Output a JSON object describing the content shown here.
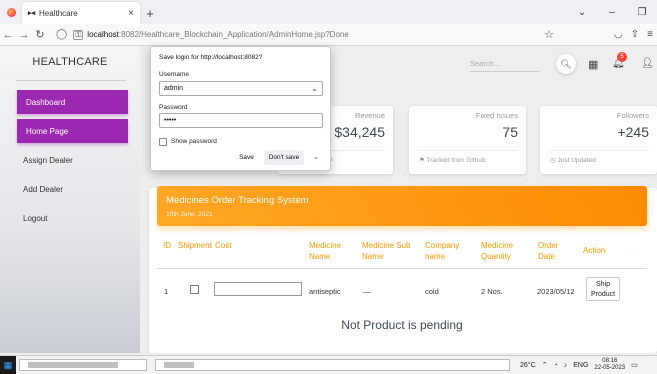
{
  "browser": {
    "tab_title": "Healthcare",
    "tab_icon": "healthcare-logo",
    "url_host": "localhost",
    "url_path": ":8082/Healthcare_Blockchain_Application/AdminHome.jsp?Done"
  },
  "sidebar": {
    "brand": "HEALTHCARE",
    "items": [
      {
        "label": "Dashboard",
        "active": true
      },
      {
        "label": "Home Page",
        "active": true
      },
      {
        "label": "Assign Dealer",
        "active": false
      },
      {
        "label": "Add Dealer",
        "active": false
      },
      {
        "label": "Logout",
        "active": false
      }
    ]
  },
  "header": {
    "search_placeholder": "Search...",
    "notification_count": "5"
  },
  "stats": [
    {
      "label": "Revenue",
      "value": "$34,245",
      "footer": "...s"
    },
    {
      "label": "Fixed Issues",
      "value": "75",
      "footer": "Tracked from Github"
    },
    {
      "label": "Followers",
      "value": "+245",
      "footer": "Just Updated"
    }
  ],
  "orders": {
    "title": "Medicines Order Tracking System",
    "date": "10th June, 2021",
    "columns": [
      "ID",
      "Shipment",
      "Cost",
      "Medicine Name",
      "Medicine Sub Name",
      "Company name",
      "Medicine Quantity",
      "Order Date",
      "Action"
    ],
    "row": {
      "id": "1",
      "medicine_name": "antiseptic",
      "sub_name": "—",
      "company": "cold",
      "quantity": "2 Nos.",
      "order_date": "2023/05/12",
      "action": "Ship Product"
    },
    "pending_message": "Not Product is pending"
  },
  "login_popup": {
    "title": "Save login for http://localhost:8082?",
    "username_label": "Username",
    "username_value": "admin",
    "password_label": "Password",
    "password_value": "•••••",
    "show_password": "Show password",
    "save": "Save",
    "dont_save": "Don't save"
  },
  "taskbar": {
    "temperature": "26°C",
    "language": "ENG",
    "time": "08:16",
    "date": "22-05-2023"
  }
}
